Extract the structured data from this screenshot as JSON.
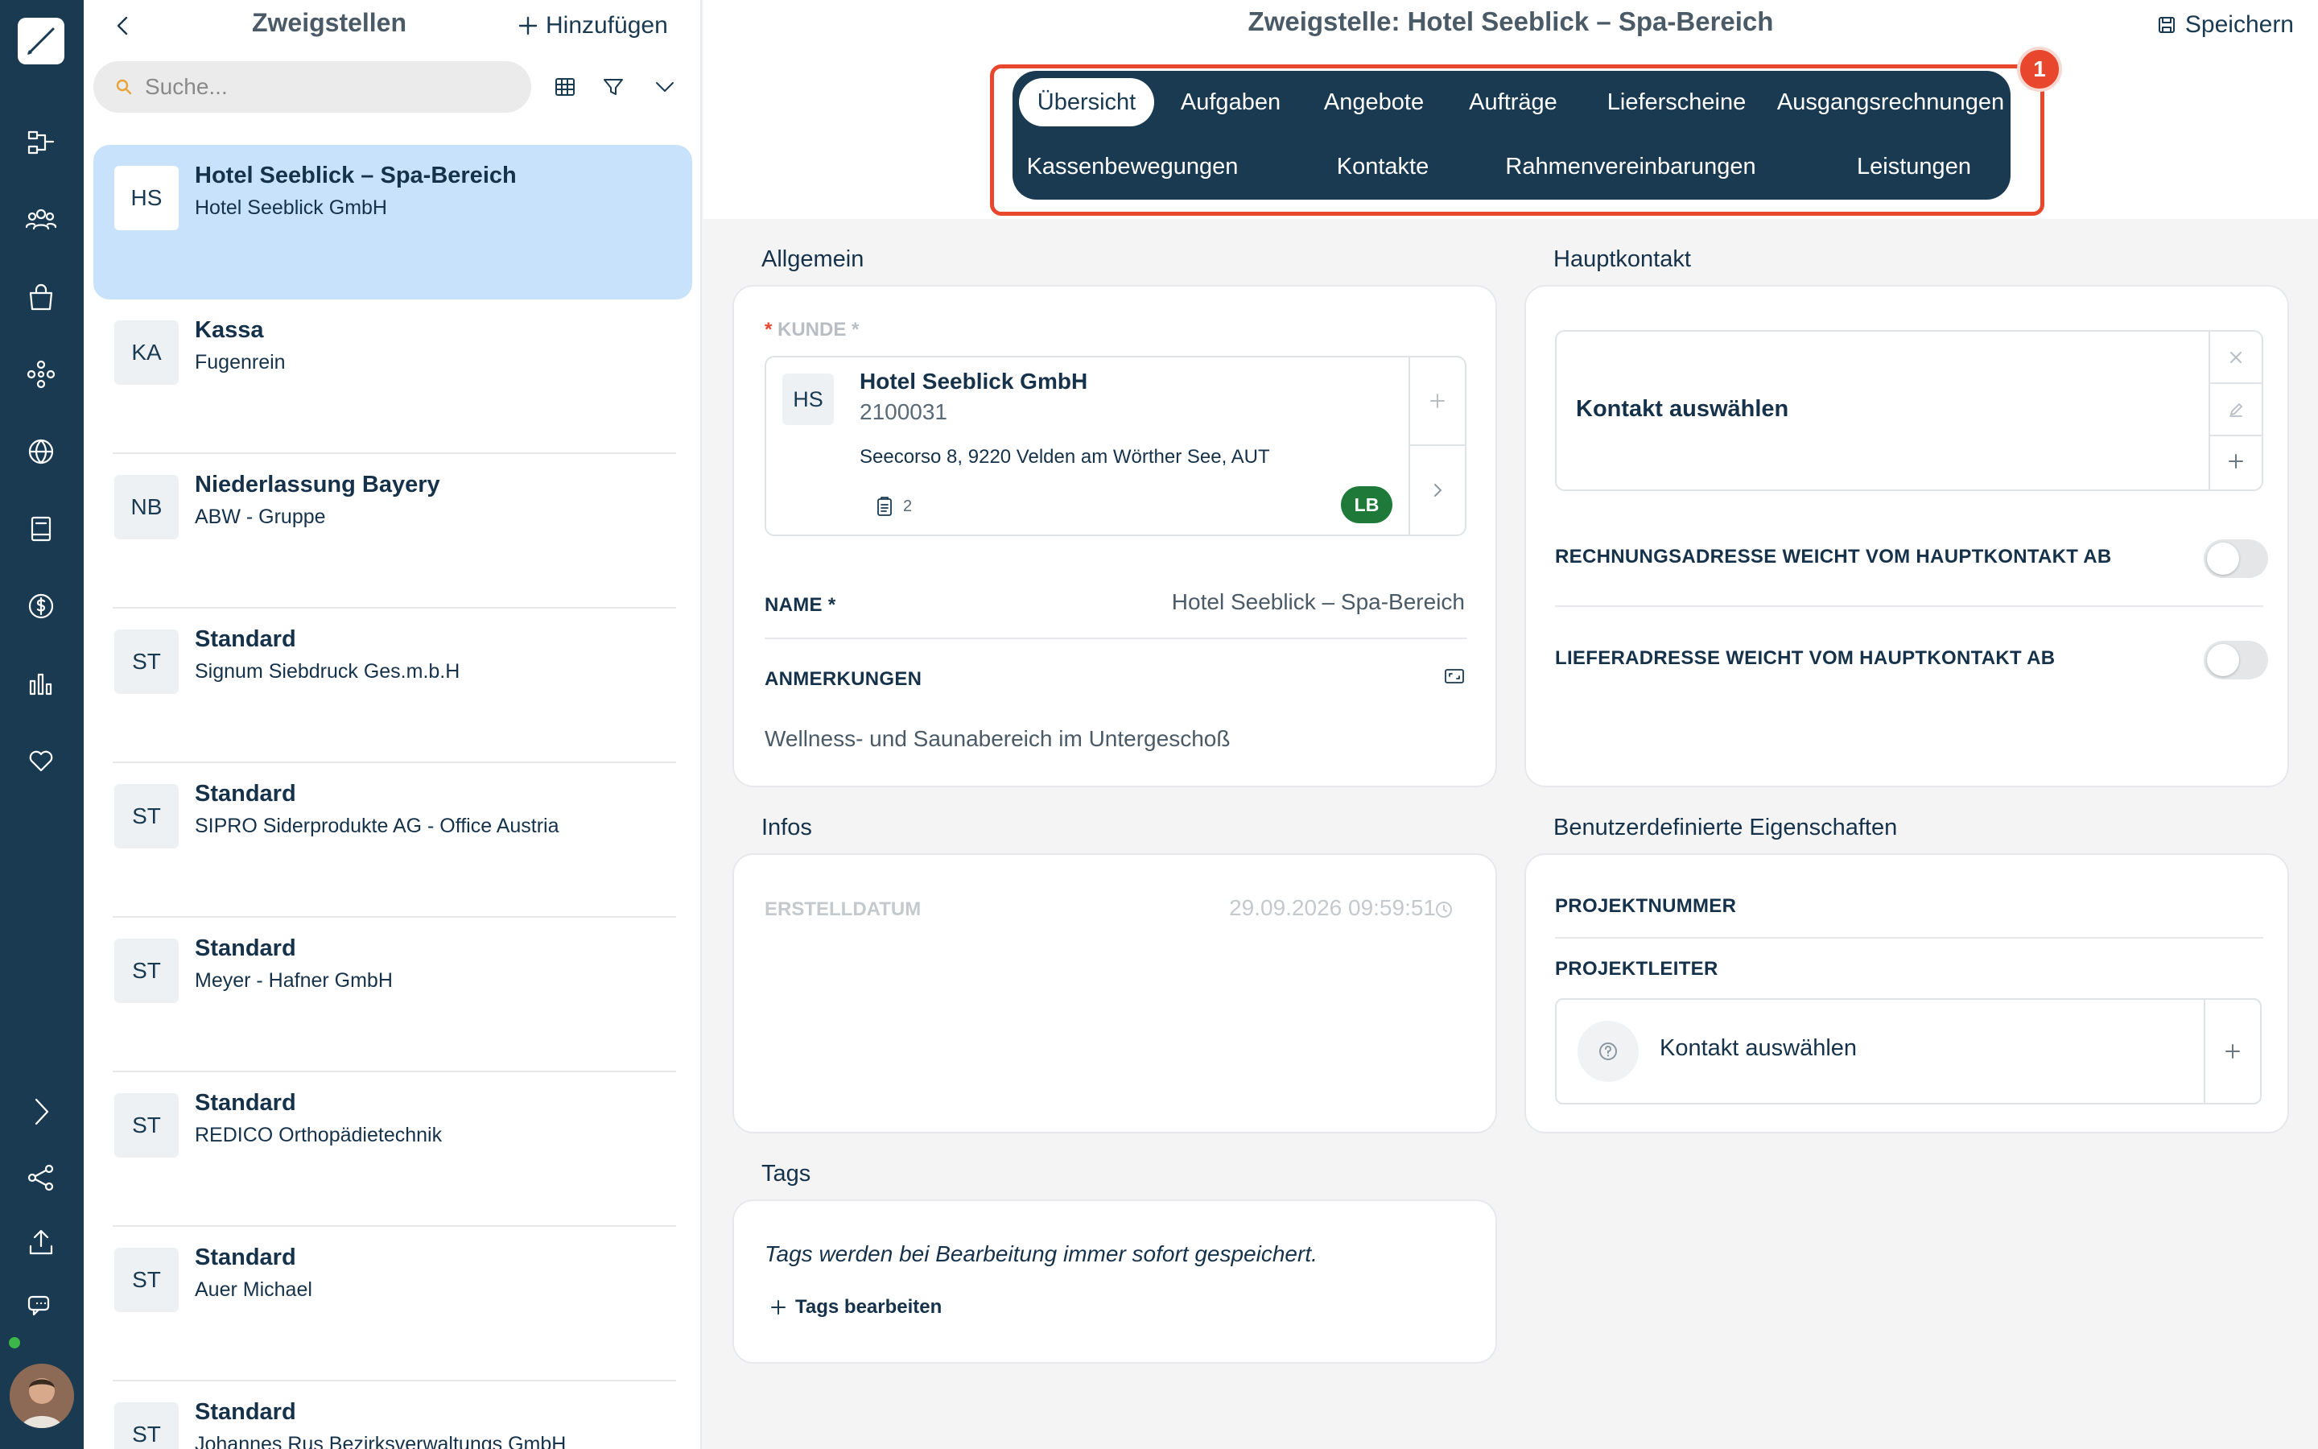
{
  "rail": {
    "icons": [
      "logo-brush-icon",
      "workflow-icon",
      "users-icon",
      "shopping-bag-icon",
      "network-icon",
      "globe-icon",
      "book-icon",
      "dollar-icon",
      "bar-chart-icon",
      "heart-icon",
      "chevron-right-icon",
      "share-icon",
      "upload-icon",
      "chat-icon"
    ]
  },
  "list": {
    "title": "Zweigstellen",
    "add_label": "Hinzufügen",
    "search_placeholder": "Suche...",
    "items": [
      {
        "initials": "HS",
        "title": "Hotel Seeblick – Spa-Bereich",
        "subtitle": "Hotel Seeblick GmbH"
      },
      {
        "initials": "KA",
        "title": "Kassa",
        "subtitle": "Fugenrein"
      },
      {
        "initials": "NB",
        "title": "Niederlassung Bayery",
        "subtitle": "ABW - Gruppe"
      },
      {
        "initials": "ST",
        "title": "Standard",
        "subtitle": "Signum Siebdruck Ges.m.b.H"
      },
      {
        "initials": "ST",
        "title": "Standard",
        "subtitle": "SIPRO Siderprodukte AG - Office Austria"
      },
      {
        "initials": "ST",
        "title": "Standard",
        "subtitle": "Meyer - Hafner GmbH"
      },
      {
        "initials": "ST",
        "title": "Standard",
        "subtitle": "REDICO Orthopädietechnik"
      },
      {
        "initials": "ST",
        "title": "Standard",
        "subtitle": "Auer Michael"
      },
      {
        "initials": "ST",
        "title": "Standard",
        "subtitle": "Johannes Rus Bezirksverwaltungs GmbH"
      }
    ]
  },
  "header": {
    "title": "Zweigstelle: Hotel Seeblick – Spa-Bereich",
    "save_label": "Speichern",
    "badge_number": "1"
  },
  "tabs": [
    {
      "label": "Übersicht",
      "active": true
    },
    {
      "label": "Aufgaben"
    },
    {
      "label": "Angebote"
    },
    {
      "label": "Aufträge"
    },
    {
      "label": "Lieferscheine"
    },
    {
      "label": "Ausgangsrechnungen"
    },
    {
      "label": "Kassenbewegungen"
    },
    {
      "label": "Kontakte"
    },
    {
      "label": "Rahmenvereinbarungen"
    },
    {
      "label": "Leistungen"
    }
  ],
  "allgemein": {
    "heading": "Allgemein",
    "kunde_label": "KUNDE",
    "kunde": {
      "initials": "HS",
      "name": "Hotel Seeblick GmbH",
      "number": "2100031",
      "address": "Seecorso 8, 9220 Velden am Wörther See, AUT",
      "doc_count": "2",
      "badge": "LB"
    },
    "name_label": "NAME *",
    "name_value": "Hotel Seeblick – Spa-Bereich",
    "anmerkungen_label": "ANMERKUNGEN",
    "anmerkungen_value": "Wellness- und Saunabereich im Untergeschoß"
  },
  "hauptkontakt": {
    "heading": "Hauptkontakt",
    "select_label": "Kontakt auswählen",
    "toggle1_label": "RECHNUNGSADRESSE WEICHT VOM HAUPTKONTAKT AB",
    "toggle2_label": "LIEFERADRESSE WEICHT VOM HAUPTKONTAKT AB"
  },
  "infos": {
    "heading": "Infos",
    "created_label": "ERSTELLDATUM",
    "created_value": "29.09.2026 09:59:51"
  },
  "custom": {
    "heading": "Benutzerdefinierte Eigenschaften",
    "projektnummer_label": "PROJEKTNUMMER",
    "projektleiter_label": "PROJEKTLEITER",
    "projektleiter_select": "Kontakt auswählen"
  },
  "tags": {
    "heading": "Tags",
    "note": "Tags werden bei Bearbeitung immer sofort gespeichert.",
    "edit_label": "Tags bearbeiten"
  },
  "colors": {
    "primary": "#1a3a52",
    "selected_bg": "#c9e2fb",
    "highlight": "#e8472e",
    "badge_green": "#1f7a3a"
  }
}
